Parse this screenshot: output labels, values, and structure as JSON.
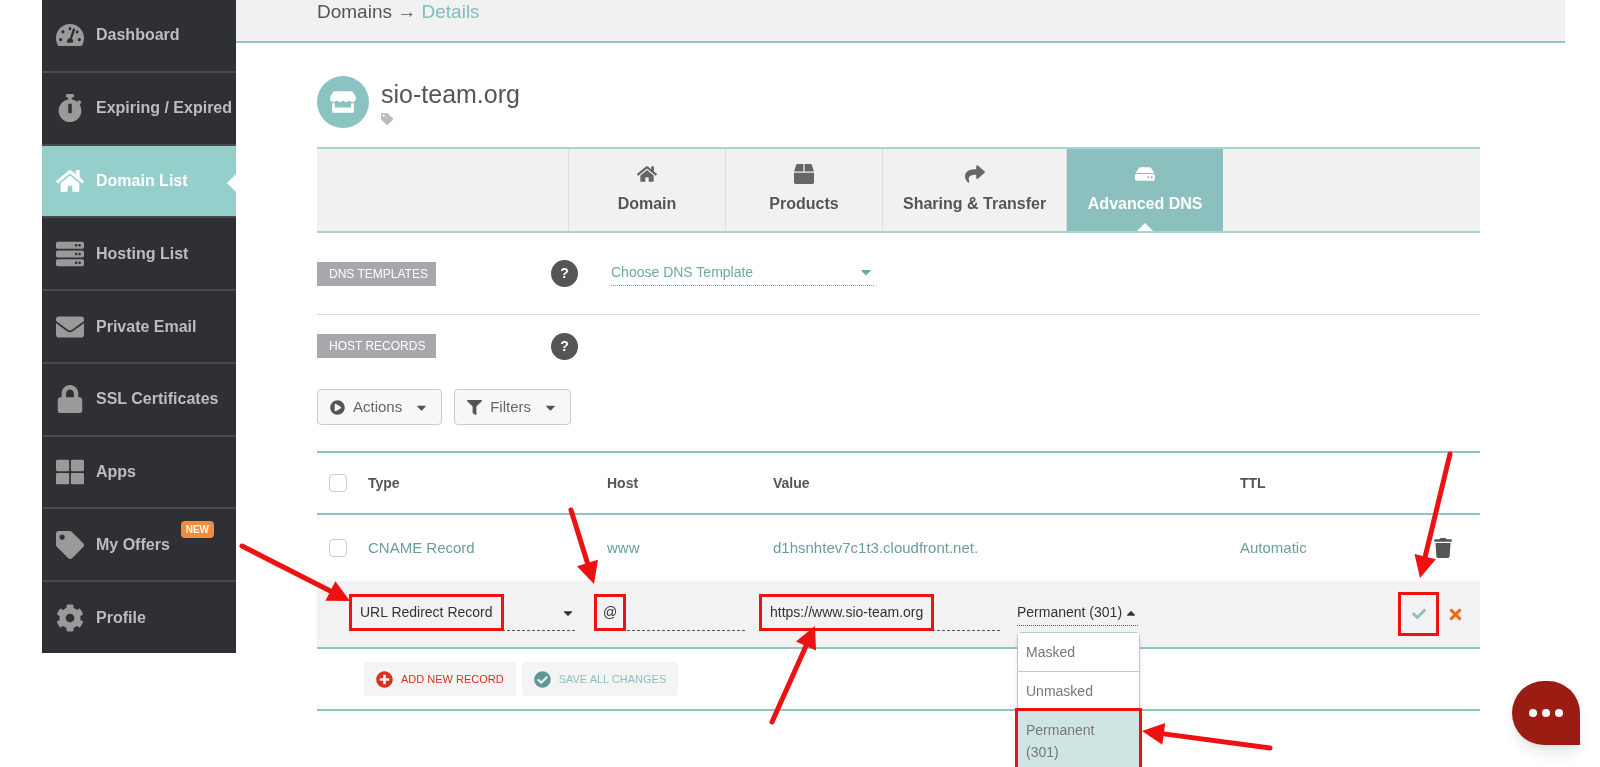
{
  "breadcrumb": {
    "parent": "Domains",
    "arrow": "→",
    "current": "Details"
  },
  "sidebar": {
    "items": [
      {
        "label": "Dashboard",
        "selected": false
      },
      {
        "label": "Expiring / Expired",
        "selected": false
      },
      {
        "label": "Domain List",
        "selected": true
      },
      {
        "label": "Hosting List",
        "selected": false
      },
      {
        "label": "Private Email",
        "selected": false
      },
      {
        "label": "SSL Certificates",
        "selected": false
      },
      {
        "label": "Apps",
        "selected": false
      },
      {
        "label": "My Offers",
        "selected": false,
        "badge": "NEW"
      },
      {
        "label": "Profile",
        "selected": false
      }
    ]
  },
  "domain": {
    "name": "sio-team.org"
  },
  "tabs": [
    {
      "label": "Domain",
      "selected": false
    },
    {
      "label": "Products",
      "selected": false
    },
    {
      "label": "Sharing & Transfer",
      "selected": false
    },
    {
      "label": "Advanced DNS",
      "selected": true
    }
  ],
  "dns_templates": {
    "label": "DNS TEMPLATES",
    "help": "?",
    "select": {
      "value": "Choose DNS Template"
    }
  },
  "host_records": {
    "label": "HOST RECORDS",
    "help": "?"
  },
  "toolbar": [
    {
      "label": "Actions"
    },
    {
      "label": "Filters"
    }
  ],
  "table": {
    "columns": [
      "Type",
      "Host",
      "Value",
      "TTL"
    ],
    "select_all_checked": false,
    "rows": [
      {
        "type": "CNAME Record",
        "host": "www",
        "value": "d1hsnhtev7c1t3.cloudfront.net.",
        "ttl": "Automatic",
        "checked": false
      }
    ]
  },
  "edit_row": {
    "type": {
      "value": "URL Redirect Record",
      "highlighted": true
    },
    "host": {
      "value": "@",
      "highlighted": true
    },
    "value": {
      "value": "https://www.sio-team.org",
      "highlighted": true
    },
    "redirect": {
      "value": "Permanent (301)",
      "expanded": true,
      "options": [
        {
          "label": "Masked",
          "selected": false,
          "highlighted": false
        },
        {
          "label": "Unmasked",
          "selected": false,
          "highlighted": false
        },
        {
          "label": "Permanent (301)",
          "selected": true,
          "highlighted": true
        }
      ]
    },
    "save_highlighted": true
  },
  "actions": [
    {
      "label": "ADD NEW RECORD",
      "kind": "add"
    },
    {
      "label": "SAVE ALL CHANGES",
      "kind": "save"
    }
  ]
}
